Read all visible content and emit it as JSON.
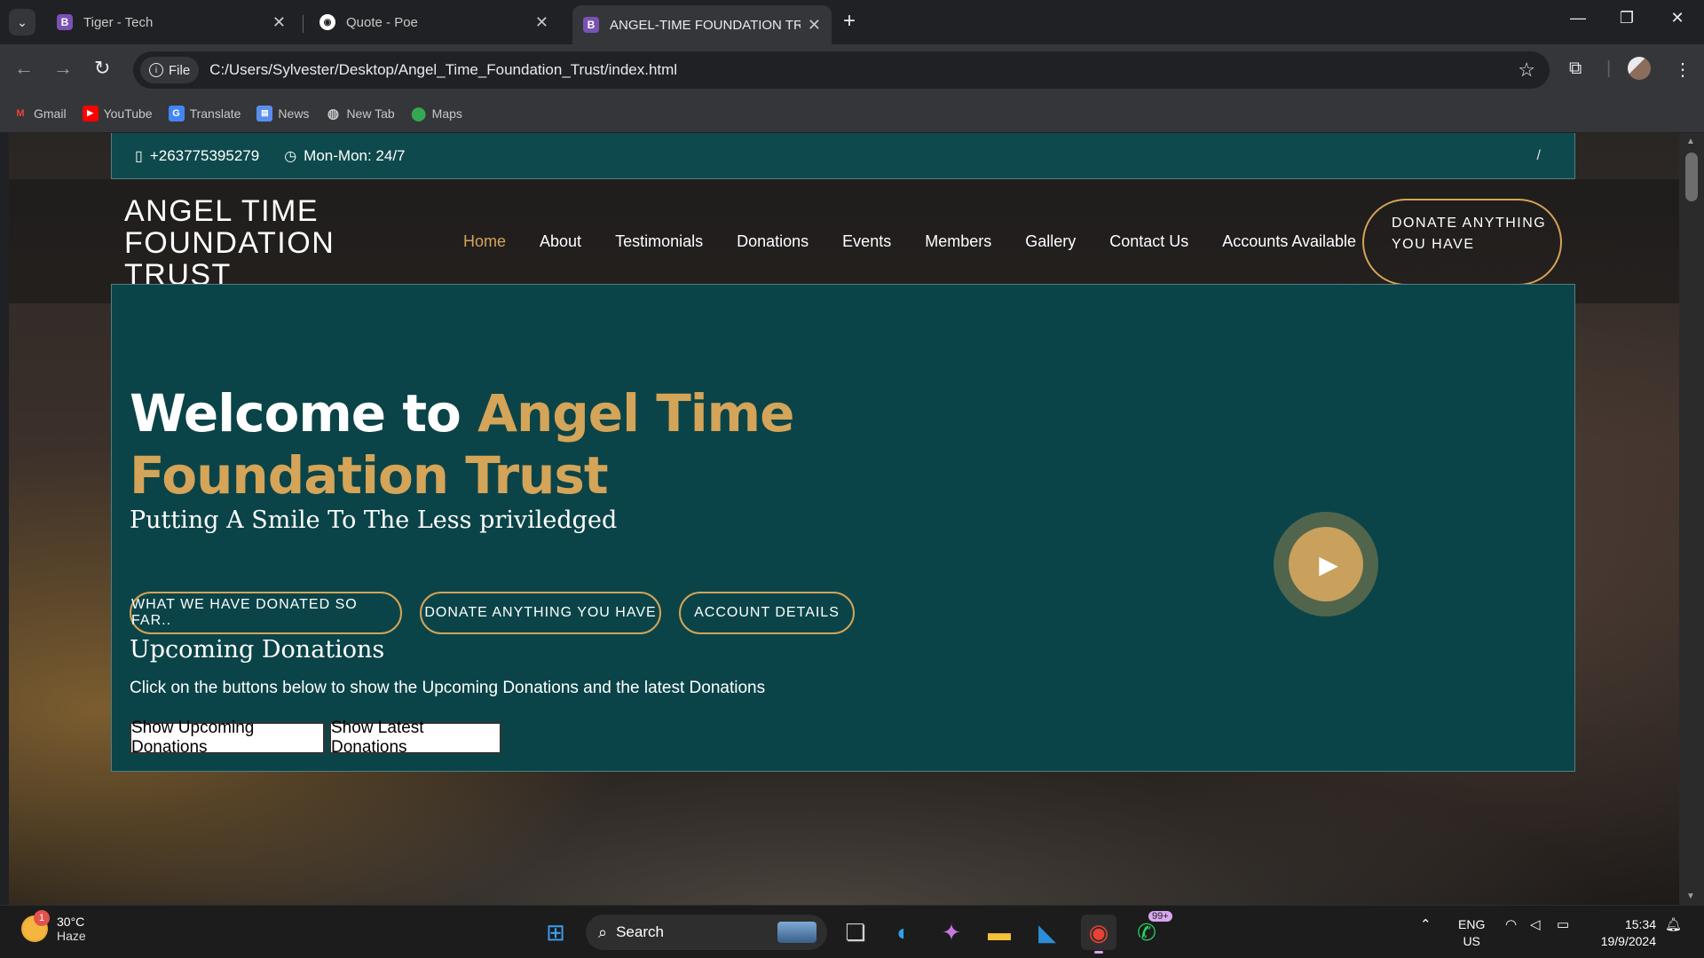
{
  "browser": {
    "tabs": [
      {
        "title": "Tiger - Tech",
        "favicon": "bootstrap-icon"
      },
      {
        "title": "Quote - Poe",
        "favicon": "poe-icon"
      },
      {
        "title": "ANGEL-TIME FOUNDATION TR",
        "favicon": "bootstrap-icon",
        "active": true
      }
    ],
    "file_chip": "File",
    "url": "C:/Users/Sylvester/Desktop/Angel_Time_Foundation_Trust/index.html",
    "bookmarks": [
      "Gmail",
      "YouTube",
      "Translate",
      "News",
      "New Tab",
      "Maps"
    ]
  },
  "site": {
    "topbar": {
      "phone": "+263775395279",
      "hours": "Mon-Mon: 24/7",
      "slash": "/"
    },
    "brand": "ANGEL TIME FOUNDATION TRUST",
    "menu": [
      "Home",
      "About",
      "Testimonials",
      "Donations",
      "Events",
      "Members",
      "Gallery",
      "Contact Us",
      "Accounts Available"
    ],
    "donate_pill": "DONATE ANYTHING YOU HAVE",
    "hero": {
      "title_white": "Welcome to ",
      "title_gold": "Angel Time Foundation Trust",
      "tagline": "Putting A Smile To The Less priviledged",
      "buttons": [
        "WHAT WE HAVE DONATED SO FAR..",
        "DONATE ANYTHING YOU HAVE",
        "ACCOUNT DETAILS"
      ],
      "upcoming_heading": "Upcoming Donations",
      "upcoming_text": "Click on the buttons below to show the Upcoming Donations and the latest Donations",
      "show_upcoming": "Show Upcoming Donations",
      "show_latest": "Show Latest Donations"
    },
    "colors": {
      "teal": "#0b4448",
      "gold": "#d4a458"
    }
  },
  "taskbar": {
    "weather_temp": "30°C",
    "weather_desc": "Haze",
    "weather_badge": "1",
    "search_label": "Search",
    "whatsapp_badge": "99+",
    "lang_top": "ENG",
    "lang_bottom": "US",
    "time": "15:34",
    "date": "19/9/2024"
  }
}
